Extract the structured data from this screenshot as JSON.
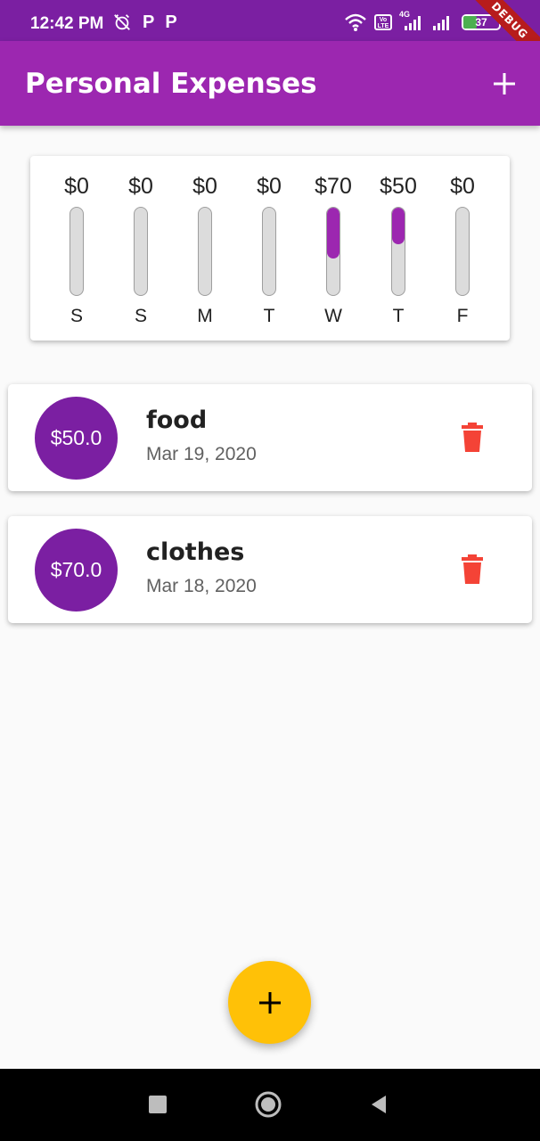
{
  "status_bar": {
    "time": "12:42 PM",
    "battery": "37",
    "icons": [
      "alarm-off-icon",
      "p-app-icon",
      "p-app-icon",
      "wifi-icon",
      "volte-icon",
      "signal-4g-icon",
      "signal-icon",
      "battery-charging-icon"
    ],
    "p_label": "P",
    "volte_label": "Vo LTE",
    "network_label": "4G"
  },
  "debug_banner": "DEBUG",
  "app_bar": {
    "title": "Personal Expenses",
    "add_icon": "add-icon"
  },
  "chart": {
    "days": [
      {
        "label": "S",
        "amount": "$0",
        "fraction": 0
      },
      {
        "label": "S",
        "amount": "$0",
        "fraction": 0
      },
      {
        "label": "M",
        "amount": "$0",
        "fraction": 0
      },
      {
        "label": "T",
        "amount": "$0",
        "fraction": 0
      },
      {
        "label": "W",
        "amount": "$70",
        "fraction": 0.583
      },
      {
        "label": "T",
        "amount": "$50",
        "fraction": 0.417
      },
      {
        "label": "F",
        "amount": "$0",
        "fraction": 0
      }
    ],
    "fill_color": "#9c27b0"
  },
  "transactions": [
    {
      "amount": "$50.0",
      "title": "food",
      "date": "Mar 19, 2020"
    },
    {
      "amount": "$70.0",
      "title": "clothes",
      "date": "Mar 18, 2020"
    }
  ],
  "colors": {
    "primary": "#9c27b0",
    "primary_dark": "#7b1fa2",
    "accent": "#ffc107",
    "delete": "#f44336"
  },
  "fab": {
    "icon": "add-icon"
  },
  "nav_bar": {
    "icons": [
      "recents-square-icon",
      "home-circle-icon",
      "back-triangle-icon"
    ]
  }
}
